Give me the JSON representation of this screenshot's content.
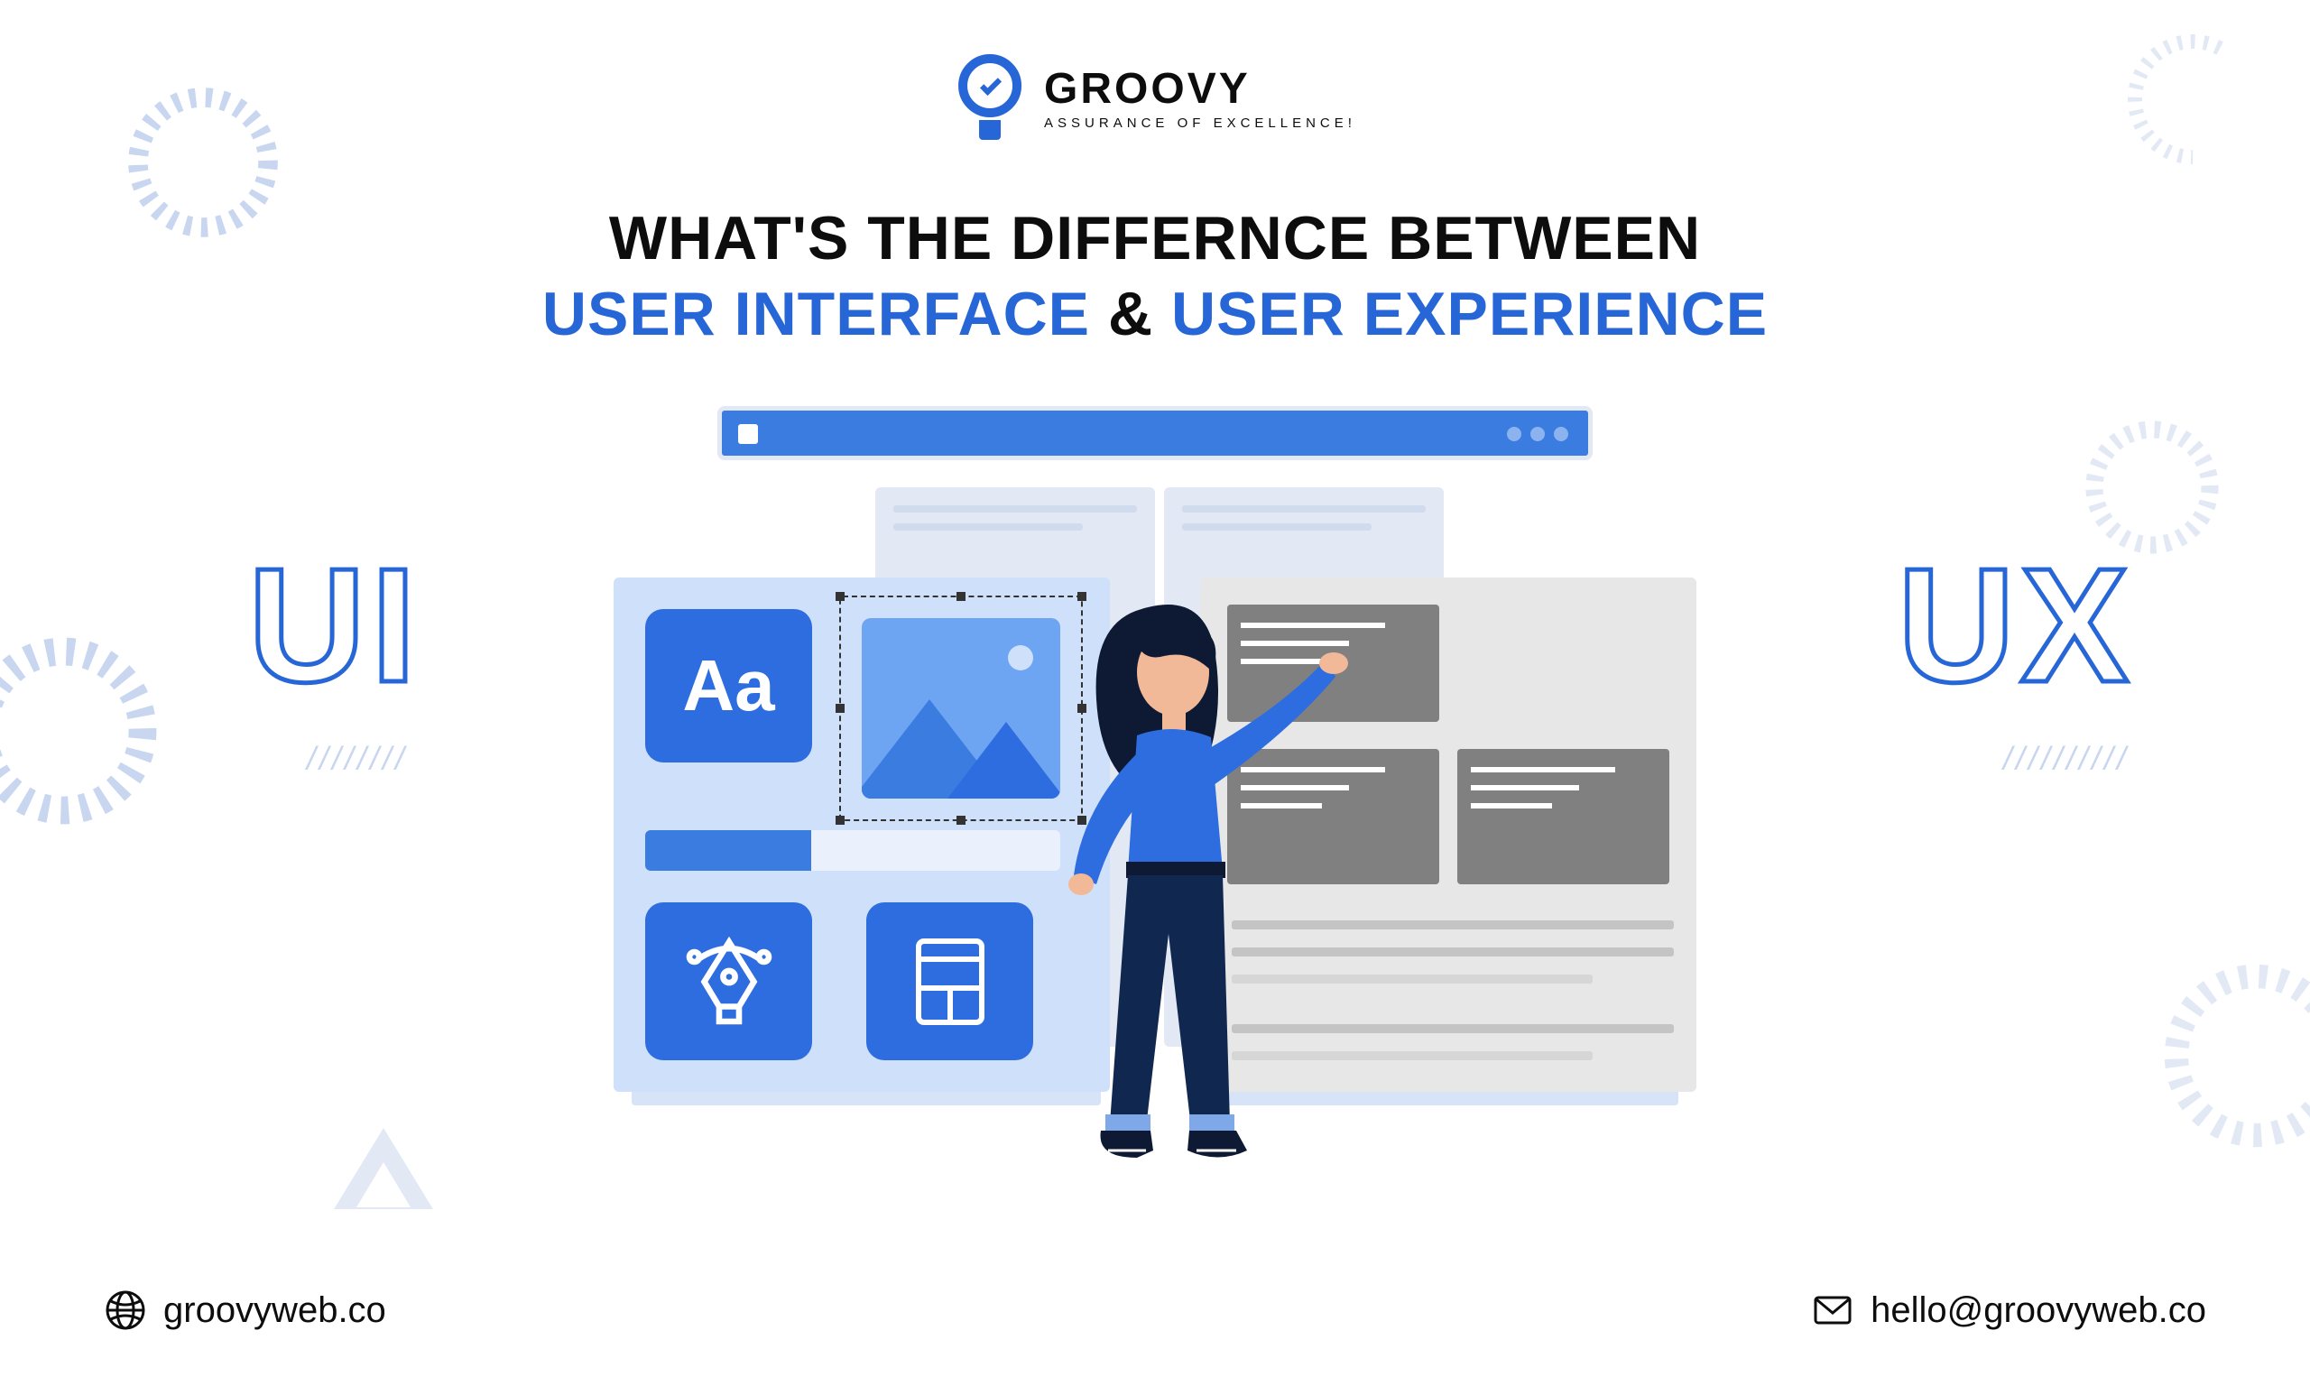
{
  "brand": {
    "name": "GROOVY",
    "tagline": "ASSURANCE OF EXCELLENCE!"
  },
  "headline": {
    "line1": "WHAT'S THE DIFFERNCE BETWEEN",
    "term1": "USER INTERFACE",
    "amp": "&",
    "term2": "USER EXPERIENCE"
  },
  "labels": {
    "ui": "UI",
    "ux": "UX"
  },
  "illustration": {
    "aa": "Aa"
  },
  "footer": {
    "website": "groovyweb.co",
    "email": "hello@groovyweb.co"
  },
  "colors": {
    "accent": "#2766d6"
  }
}
